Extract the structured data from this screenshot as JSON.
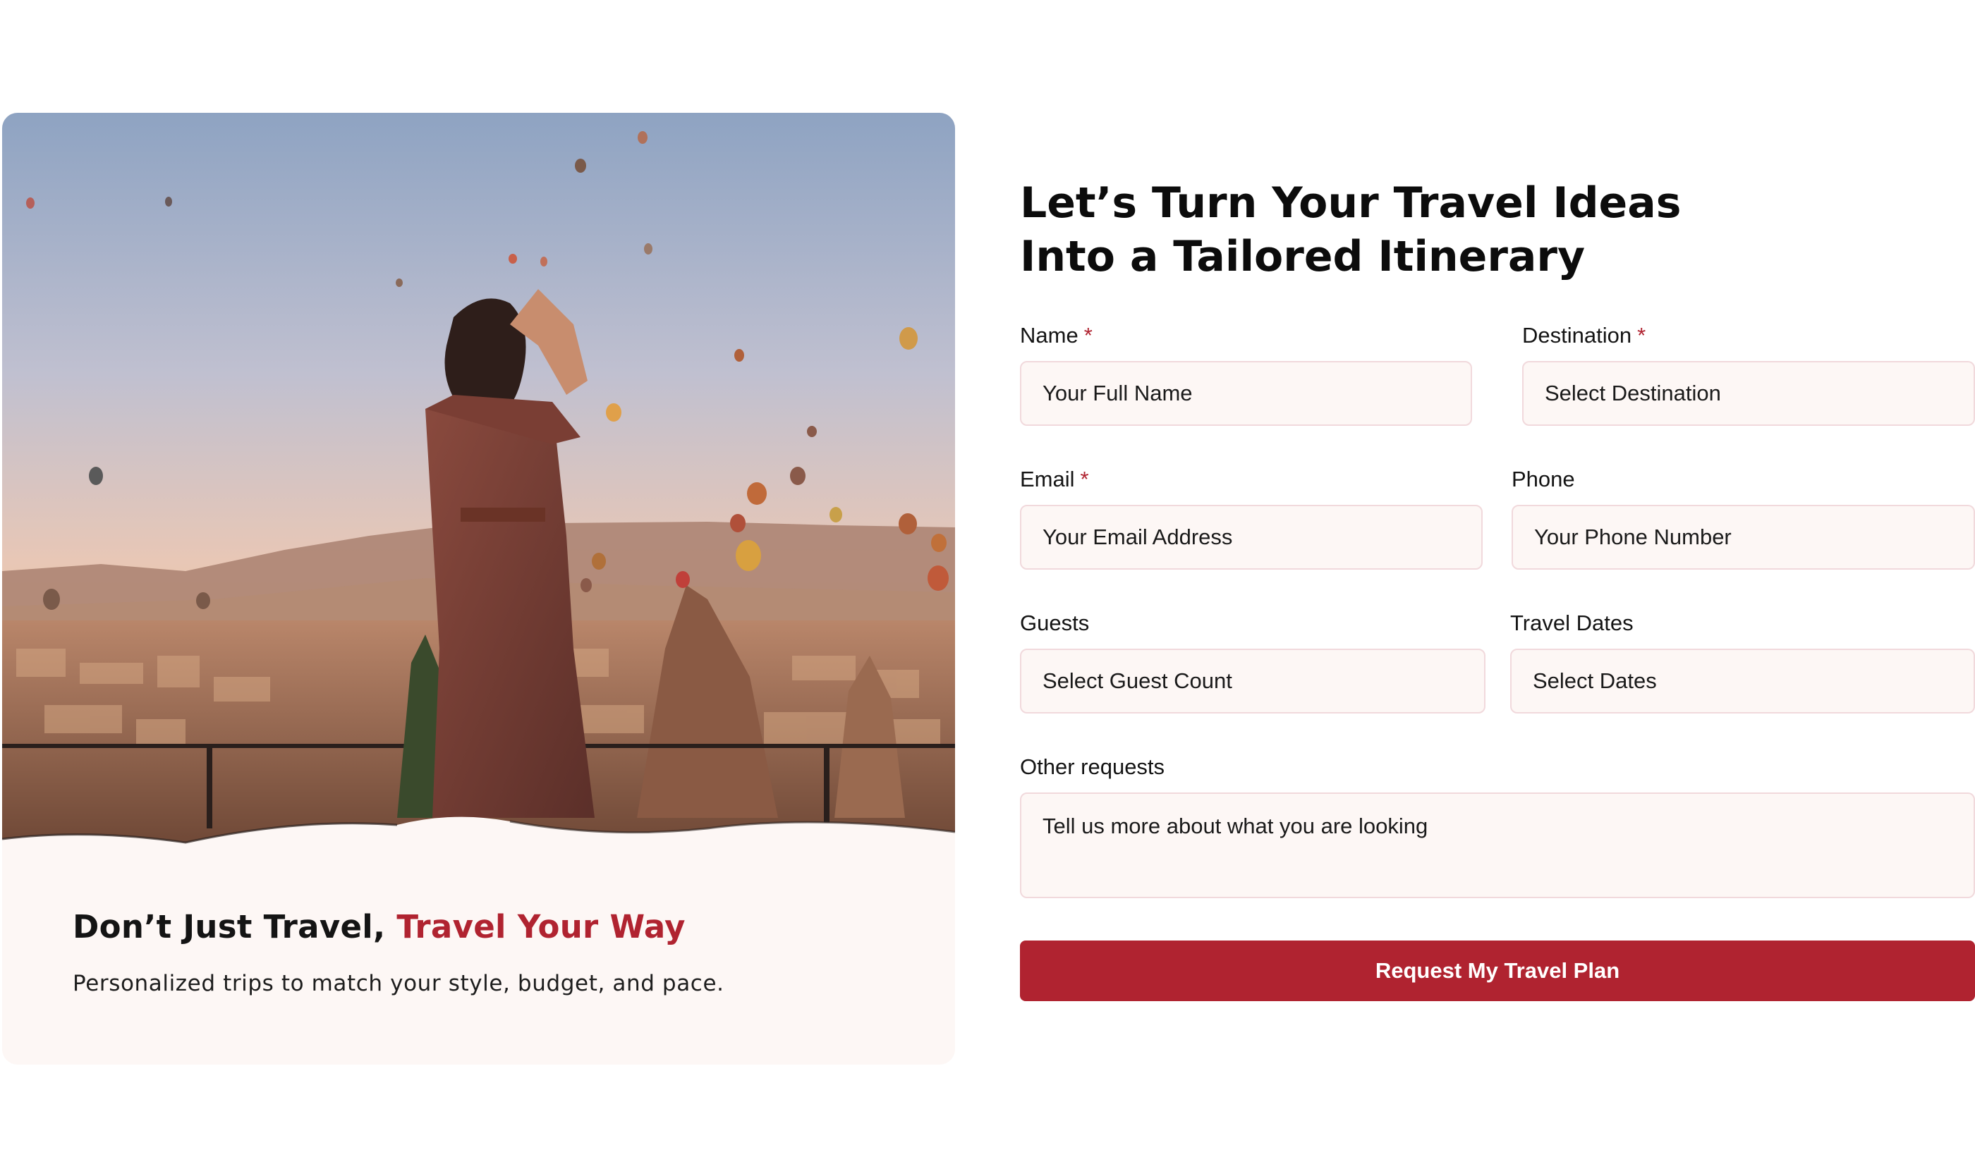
{
  "card": {
    "title_lead": "Don’t Just Travel, ",
    "title_accent": "Travel Your Way",
    "subtitle": "Personalized trips to match your style, budget, and pace.",
    "photo_icon": "hot-air-balloons-traveler-photo"
  },
  "form": {
    "headline_line1": "Let’s Turn Your Travel Ideas",
    "headline_line2": "Into a Tailored Itinerary",
    "required_mark": "*",
    "name": {
      "label": "Name",
      "placeholder": "Your Full Name"
    },
    "destination": {
      "label": "Destination",
      "placeholder": "Select Destination"
    },
    "email": {
      "label": "Email",
      "placeholder": "Your Email Address"
    },
    "phone": {
      "label": "Phone",
      "placeholder": "Your Phone Number"
    },
    "guests": {
      "label": "Guests",
      "placeholder": "Select Guest Count"
    },
    "dates": {
      "label": "Travel Dates",
      "placeholder": "Select Dates"
    },
    "requests": {
      "label": "Other requests",
      "placeholder": "Tell us more about what you are looking"
    },
    "submit_label": "Request My Travel Plan"
  },
  "colors": {
    "accent": "#b02330",
    "field_bg": "#fdf7f5",
    "field_border": "#f1d9dc"
  }
}
